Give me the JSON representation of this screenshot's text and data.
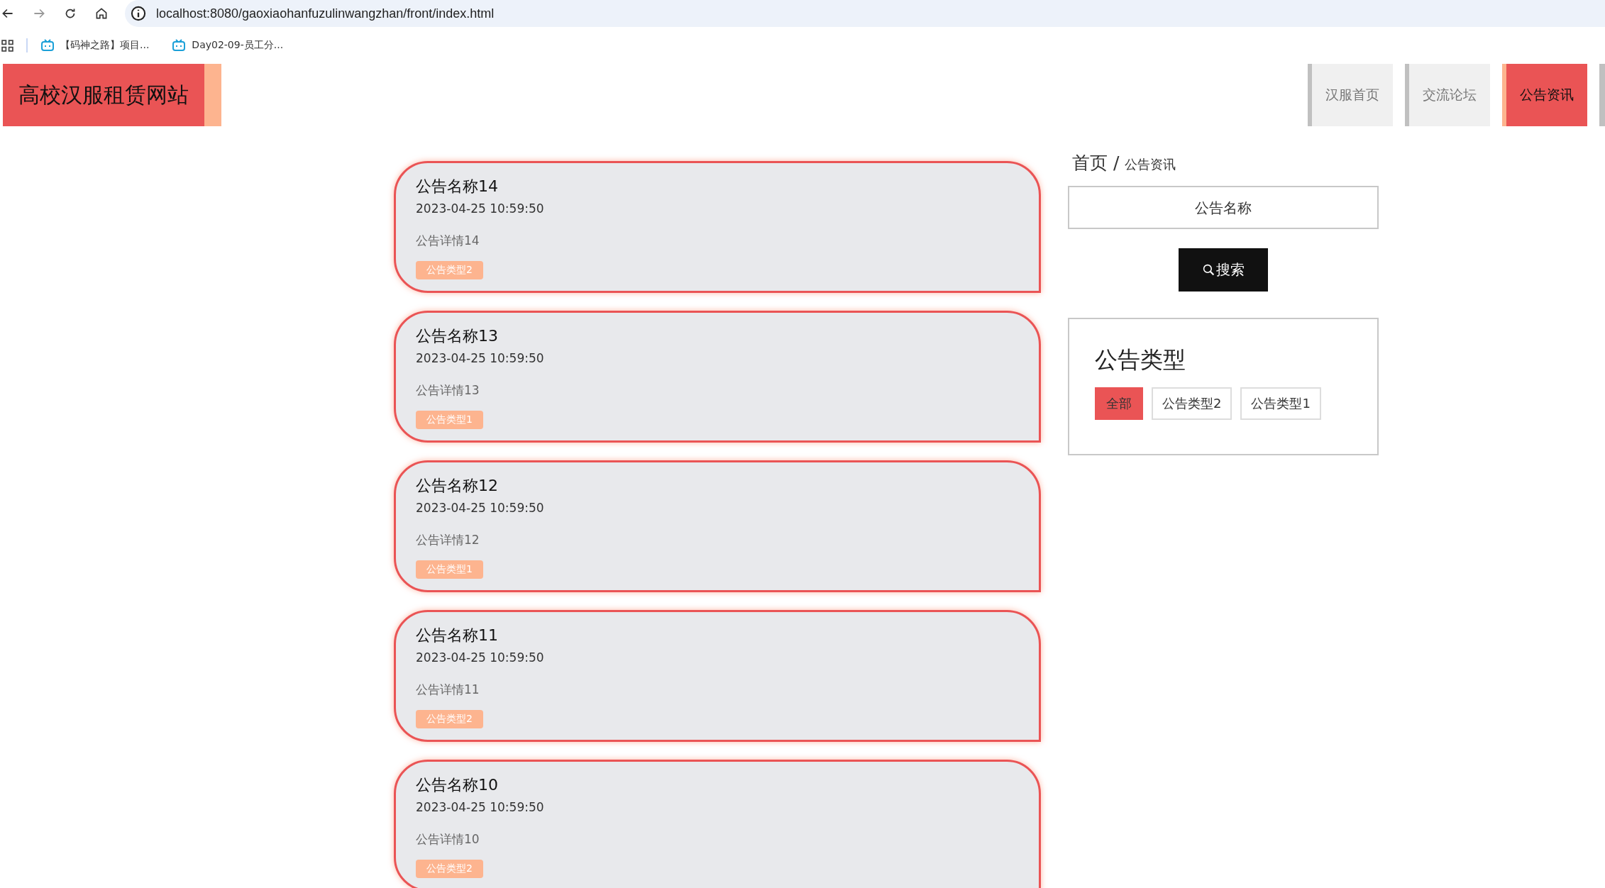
{
  "browser": {
    "url": "localhost:8080/gaoxiaohanfuzulinwangzhan/front/index.html",
    "bookmarks": [
      "【码神之路】项目...",
      "Day02-09-员工分..."
    ]
  },
  "header": {
    "logo": "高校汉服租赁网站",
    "nav": [
      {
        "label": "汉服首页",
        "selected": false
      },
      {
        "label": "交流论坛",
        "selected": false
      },
      {
        "label": "公告资讯",
        "selected": true
      }
    ]
  },
  "notices": [
    {
      "title": "公告名称14",
      "time": "2023-04-25 10:59:50",
      "detail": "公告详情14",
      "tag": "公告类型2"
    },
    {
      "title": "公告名称13",
      "time": "2023-04-25 10:59:50",
      "detail": "公告详情13",
      "tag": "公告类型1"
    },
    {
      "title": "公告名称12",
      "time": "2023-04-25 10:59:50",
      "detail": "公告详情12",
      "tag": "公告类型1"
    },
    {
      "title": "公告名称11",
      "time": "2023-04-25 10:59:50",
      "detail": "公告详情11",
      "tag": "公告类型2"
    },
    {
      "title": "公告名称10",
      "time": "2023-04-25 10:59:50",
      "detail": "公告详情10",
      "tag": "公告类型2"
    }
  ],
  "breadcrumb": {
    "home": "首页",
    "separator": "/",
    "current": "公告资讯"
  },
  "search": {
    "placeholder": "公告名称",
    "button": "搜索"
  },
  "types": {
    "title": "公告类型",
    "items": [
      {
        "label": "全部",
        "selected": true
      },
      {
        "label": "公告类型2",
        "selected": false
      },
      {
        "label": "公告类型1",
        "selected": false
      }
    ]
  }
}
